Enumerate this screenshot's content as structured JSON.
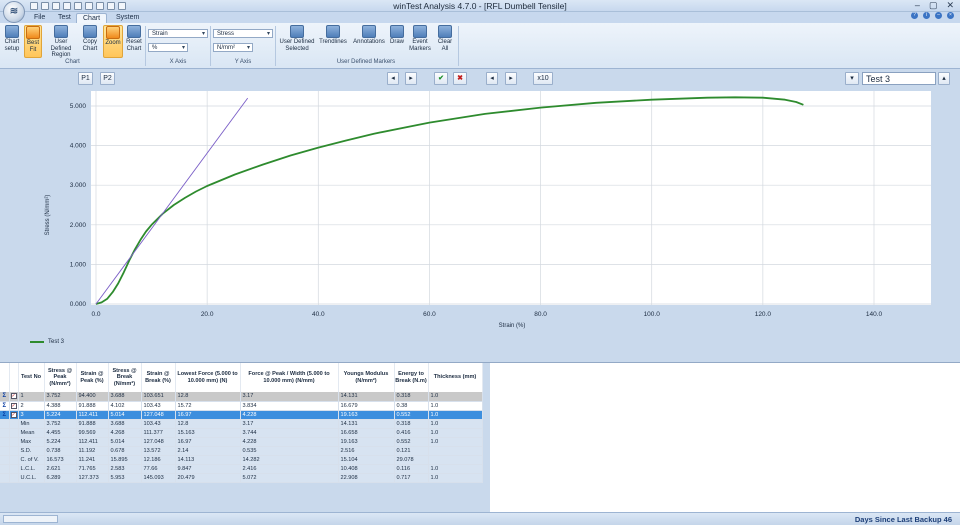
{
  "window": {
    "title": "winTest Analysis 4.7.0 - [RFL Dumbell Tensile]"
  },
  "tabs": [
    "File",
    "Test",
    "Chart",
    "System"
  ],
  "active_tab": "Chart",
  "ribbon": {
    "chart_setup": "Chart setup",
    "best_fit": "Best Fit",
    "user_defined_region": "User Defined Region",
    "copy_chart": "Copy Chart",
    "zoom": "Zoom",
    "reset_chart": "Reset Chart",
    "x_axis_quantity": "Strain",
    "x_axis_unit": "%",
    "y_axis_quantity": "Stress",
    "y_axis_unit": "N/mm²",
    "user_defined_selected": "User Defined Selected",
    "trendlines": "Trendlines",
    "annotations": "Annotations",
    "draw": "Draw",
    "event_markers": "Event Markers",
    "clear_all": "Clear All",
    "group_chart": "Chart",
    "group_x_axis": "X Axis",
    "group_y_axis": "Y Axis",
    "group_udm": "User Defined Markers"
  },
  "toolbar": {
    "p1": "P1",
    "p2": "P2",
    "x10": "x10",
    "test_select": "Test 3"
  },
  "chart_data": {
    "type": "line",
    "xlabel": "Strain (%)",
    "ylabel": "Stress (N/mm²)",
    "xlim": [
      0,
      150
    ],
    "ylim": [
      0,
      5.3
    ],
    "x_ticks": [
      "0.0",
      "20.0",
      "40.0",
      "60.0",
      "80.0",
      "100.0",
      "120.0",
      "140.0"
    ],
    "y_ticks": [
      "0.000",
      "1.000",
      "2.000",
      "3.000",
      "4.000",
      "5.000"
    ],
    "grid": true,
    "legend_position": "bottom-left",
    "series": [
      {
        "name": "Test 3",
        "color": "#2e8b2e",
        "x": [
          0,
          1,
          2,
          3,
          4,
          5,
          6,
          7,
          8,
          9,
          10,
          12,
          14,
          16,
          18,
          20,
          25,
          30,
          35,
          40,
          45,
          50,
          60,
          70,
          80,
          90,
          100,
          110,
          115,
          120,
          124,
          126,
          127.3
        ],
        "y": [
          0.0,
          0.04,
          0.13,
          0.3,
          0.52,
          0.8,
          1.1,
          1.38,
          1.62,
          1.83,
          2.0,
          2.28,
          2.5,
          2.68,
          2.84,
          2.98,
          3.27,
          3.52,
          3.75,
          3.95,
          4.13,
          4.3,
          4.58,
          4.8,
          4.96,
          5.08,
          5.16,
          5.21,
          5.22,
          5.21,
          5.16,
          5.1,
          5.03
        ]
      },
      {
        "color": "#7b5fc7",
        "x": [
          0,
          27.3
        ],
        "y": [
          0.0,
          5.2
        ]
      }
    ]
  },
  "table": {
    "headers": [
      "Test No",
      "Stress @ Peak (N/mm²)",
      "Strain @ Peak (%)",
      "Stress @ Break (N/mm²)",
      "Strain @ Break (%)",
      "Lowest Force (5.000 to 10.000 mm) (N)",
      "Force @ Peak / Width (5.000 to 10.000 mm) (N/mm)",
      "Youngs Modulus (N/mm²)",
      "Energy to Break (N.m)",
      "Thickness (mm)"
    ],
    "rows": [
      [
        "1",
        "3.752",
        "94.400",
        "3.688",
        "103.651",
        "12.8",
        "3.17",
        "14.131",
        "0.318",
        "1.0"
      ],
      [
        "2",
        "4.388",
        "91.888",
        "4.102",
        "103.43",
        "15.72",
        "3.834",
        "16.679",
        "0.38",
        "1.0"
      ],
      [
        "3",
        "5.224",
        "112.411",
        "5.014",
        "127.048",
        "16.97",
        "4.228",
        "19.163",
        "0.552",
        "1.0"
      ],
      [
        "Min",
        "3.752",
        "91.888",
        "3.688",
        "103.43",
        "12.8",
        "3.17",
        "14.131",
        "0.318",
        "1.0"
      ],
      [
        "Mean",
        "4.455",
        "99.569",
        "4.268",
        "111.377",
        "15.163",
        "3.744",
        "16.658",
        "0.416",
        "1.0"
      ],
      [
        "Max",
        "5.224",
        "112.411",
        "5.014",
        "127.048",
        "16.97",
        "4.228",
        "19.163",
        "0.552",
        "1.0"
      ],
      [
        "S.D.",
        "0.738",
        "11.192",
        "0.678",
        "13.572",
        "2.14",
        "0.535",
        "2.516",
        "0.121",
        ""
      ],
      [
        "C. of V.",
        "16.573",
        "11.241",
        "15.895",
        "12.186",
        "14.113",
        "14.282",
        "15.104",
        "29.078",
        ""
      ],
      [
        "L.C.L.",
        "2.621",
        "71.765",
        "2.583",
        "77.66",
        "9.847",
        "2.416",
        "10.408",
        "0.116",
        "1.0"
      ],
      [
        "U.C.L.",
        "6.289",
        "127.373",
        "5.953",
        "145.093",
        "20.479",
        "5.072",
        "22.908",
        "0.717",
        "1.0"
      ]
    ]
  },
  "status": {
    "backup": "Days Since Last Backup 46"
  }
}
